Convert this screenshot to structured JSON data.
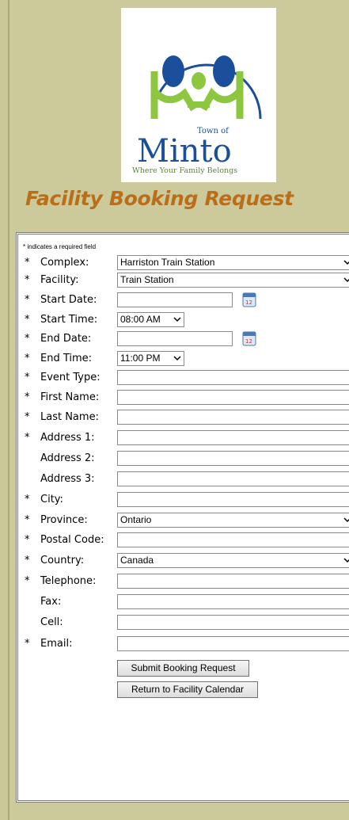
{
  "logo": {
    "town_of": "Town of",
    "name": "Minto",
    "tagline": "Where Your Family Belongs",
    "colors": {
      "blue": "#1b4f9c",
      "green": "#8dc63f"
    }
  },
  "page_title": "Facility Booking Request",
  "required_note": "* indicates a required field",
  "required_mark": "*",
  "fields": {
    "complex": {
      "label": "Complex:",
      "value": "Harriston Train Station"
    },
    "facility": {
      "label": "Facility:",
      "value": "Train Station"
    },
    "start_date": {
      "label": "Start Date:",
      "value": ""
    },
    "start_time": {
      "label": "Start Time:",
      "value": "08:00 AM"
    },
    "end_date": {
      "label": "End Date:",
      "value": ""
    },
    "end_time": {
      "label": "End Time:",
      "value": "11:00 PM"
    },
    "event_type": {
      "label": "Event Type:",
      "value": ""
    },
    "first_name": {
      "label": "First Name:",
      "value": ""
    },
    "last_name": {
      "label": "Last Name:",
      "value": ""
    },
    "address1": {
      "label": "Address 1:",
      "value": ""
    },
    "address2": {
      "label": "Address 2:",
      "value": ""
    },
    "address3": {
      "label": "Address 3:",
      "value": ""
    },
    "city": {
      "label": "City:",
      "value": ""
    },
    "province": {
      "label": "Province:",
      "value": "Ontario"
    },
    "postal_code": {
      "label": "Postal Code:",
      "value": ""
    },
    "country": {
      "label": "Country:",
      "value": "Canada"
    },
    "telephone": {
      "label": "Telephone:",
      "value": ""
    },
    "fax": {
      "label": "Fax:",
      "value": ""
    },
    "cell": {
      "label": "Cell:",
      "value": ""
    },
    "email": {
      "label": "Email:",
      "value": ""
    }
  },
  "buttons": {
    "submit": "Submit Booking Request",
    "return": "Return to Facility Calendar"
  },
  "calendar_icon_day": "12",
  "icons": {
    "dropdown": "chevron-down-icon",
    "calendar": "calendar-icon"
  }
}
